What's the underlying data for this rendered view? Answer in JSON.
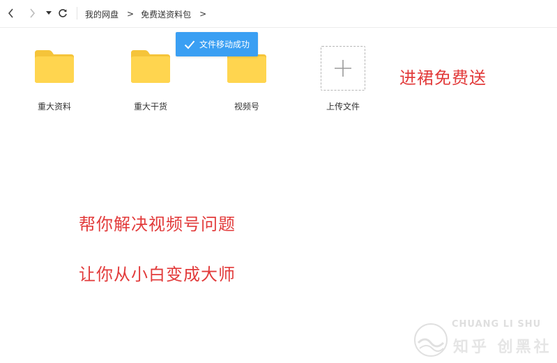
{
  "toolbar": {
    "back_icon": "chevron-left-icon",
    "forward_icon": "chevron-right-icon",
    "dropdown_icon": "caret-down-icon",
    "refresh_icon": "refresh-icon"
  },
  "breadcrumb": {
    "items": [
      "我的网盘",
      "免费送资料包"
    ],
    "separator": ">"
  },
  "toast": {
    "text": "文件移动成功",
    "icon": "check-icon",
    "color": "#3a9ff3"
  },
  "files": [
    {
      "name": "重大资料",
      "type": "folder"
    },
    {
      "name": "重大干货",
      "type": "folder"
    },
    {
      "name": "视频号",
      "type": "folder"
    }
  ],
  "upload": {
    "label": "上传文件",
    "icon": "plus-icon"
  },
  "folder_color": "#ffd54f",
  "promo": {
    "line1": "进裙免费送",
    "line2": "帮你解决视频号问题",
    "line3": "让你从小白变成大师",
    "color": "#e23b3b"
  },
  "watermark": {
    "en": "CHUANG LI SHU",
    "cn": "知乎 创黑社"
  }
}
